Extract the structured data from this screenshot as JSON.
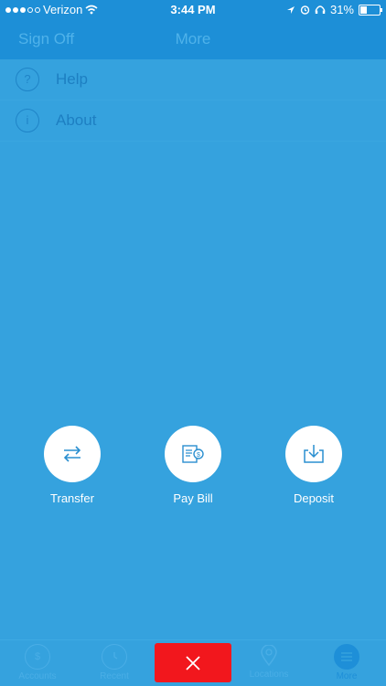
{
  "status_bar": {
    "carrier": "Verizon",
    "time": "3:44 PM",
    "battery": "31%",
    "battery_level": 0.31,
    "icons": [
      "signal-dots",
      "wifi-icon",
      "location-arrow-icon",
      "alarm-icon",
      "headphones-icon",
      "battery-icon"
    ]
  },
  "nav": {
    "left_button": "Sign Off",
    "title": "More"
  },
  "menu": {
    "items": [
      {
        "icon": "?",
        "label": "Help"
      },
      {
        "icon": "i",
        "label": "About"
      }
    ]
  },
  "actions": [
    {
      "label": "Transfer",
      "icon": "transfer-arrows-icon"
    },
    {
      "label": "Pay Bill",
      "icon": "bill-dollar-icon"
    },
    {
      "label": "Deposit",
      "icon": "deposit-tray-icon"
    }
  ],
  "tabbar": {
    "tabs": [
      {
        "label": "Accounts",
        "icon": "dollar-circle-icon"
      },
      {
        "label": "Recent",
        "icon": "clock-icon"
      },
      {
        "label": "Locations",
        "icon": "map-pin-icon"
      },
      {
        "label": "More",
        "icon": "menu-lines-icon",
        "active": true
      }
    ],
    "close_icon": "×"
  },
  "colors": {
    "background": "#35a2de",
    "header": "#1d8fd7",
    "close_button": "#f2171d",
    "action_icon": "#2a8fd0"
  }
}
